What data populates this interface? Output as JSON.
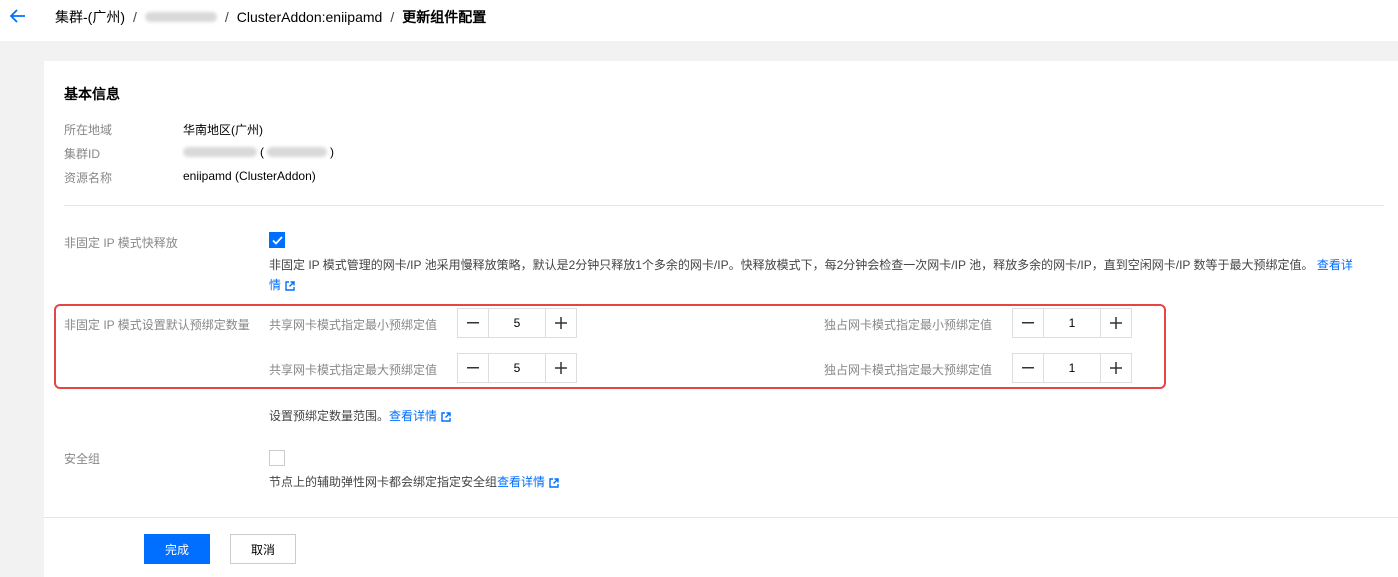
{
  "colors": {
    "primary": "#006eff",
    "highlight": "#e54545"
  },
  "header": {
    "back_icon": "arrow-left-icon",
    "breadcrumb": [
      "集群-(广州)",
      "ClusterAddon:eniipamd",
      "更新组件配置"
    ]
  },
  "basic_info": {
    "title": "基本信息",
    "region_label": "所在地域",
    "region_value": "华南地区(广州)",
    "cluster_label": "集群ID",
    "resource_label": "资源名称",
    "resource_value": "eniipamd (ClusterAddon)"
  },
  "fast_release": {
    "label": "非固定 IP 模式快释放",
    "checked": true,
    "desc_line1": "非固定 IP 模式管理的网卡/IP 池采用慢释放策略，默认是2分钟只释放1个多余的网卡/IP。快释放模式下，每2分钟会检查一次网卡/IP 池，释放多余的网卡/IP，直到空闲网卡/IP 数等于最大预绑定值。",
    "desc_link1": "查看详",
    "desc_link2": "情"
  },
  "prebind": {
    "label": "非固定 IP 模式设置默认预绑定数量",
    "shared_min_label": "共享网卡模式指定最小预绑定值",
    "shared_min_value": "5",
    "shared_max_label": "共享网卡模式指定最大预绑定值",
    "shared_max_value": "5",
    "exclusive_min_label": "独占网卡模式指定最小预绑定值",
    "exclusive_min_value": "1",
    "exclusive_max_label": "独占网卡模式指定最大预绑定值",
    "exclusive_max_value": "1",
    "hint": "设置预绑定数量范围。",
    "hint_link": "查看详情"
  },
  "security_group": {
    "label": "安全组",
    "checked": false,
    "desc": "节点上的辅助弹性网卡都会绑定指定安全组",
    "desc_link": "查看详情"
  },
  "footer": {
    "confirm_label": "完成",
    "cancel_label": "取消"
  }
}
